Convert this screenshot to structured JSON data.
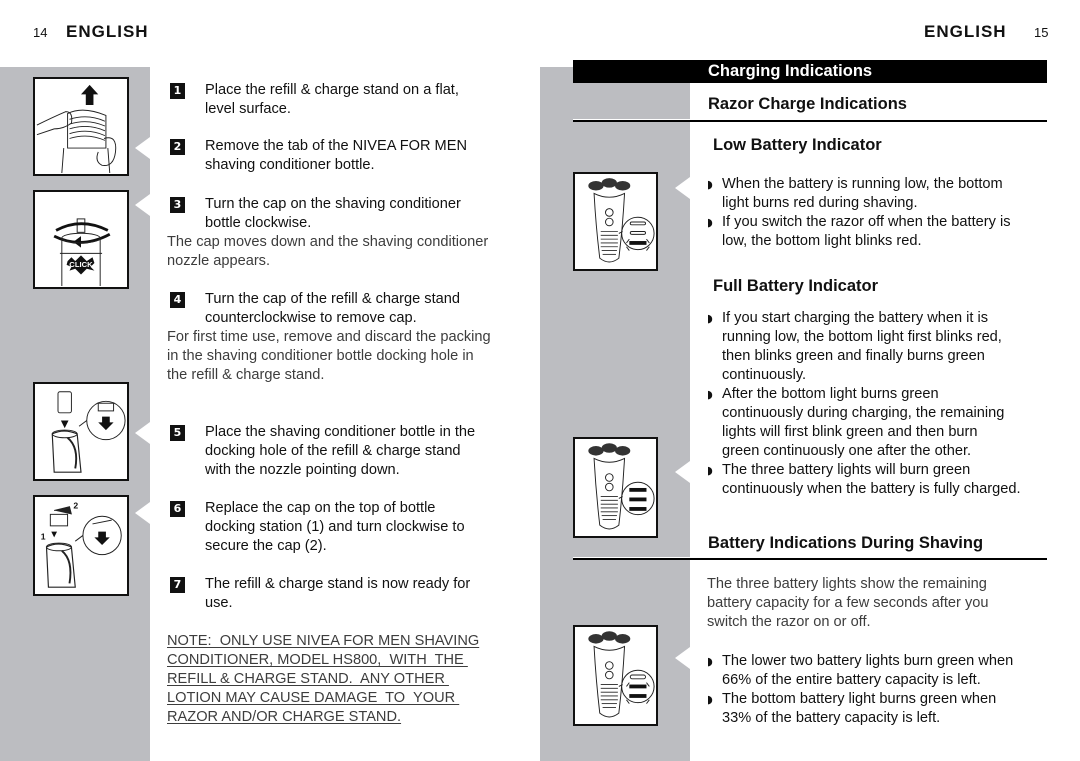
{
  "colors": {
    "panel_gray": "#bcbdc1",
    "ink": "#111111",
    "bar_black": "#000000"
  },
  "left_page": {
    "page_number": "14",
    "header": "ENGLISH",
    "illustrations": [
      {
        "name": "remove-bottle-tab-illustration"
      },
      {
        "name": "turn-bottle-cap-illustration",
        "label": "CLICK"
      },
      {
        "name": "insert-bottle-into-stand-illustration"
      },
      {
        "name": "replace-stand-cap-illustration",
        "label_1": "1",
        "label_2": "2"
      }
    ],
    "steps": [
      {
        "number": "1",
        "text": "Place the refill & charge stand on a flat,\nlevel surface."
      },
      {
        "number": "2",
        "text": "Remove the tab of the NIVEA FOR MEN\nshaving conditioner bottle."
      },
      {
        "number": "3",
        "text": "Turn the cap on the shaving conditioner\nbottle clockwise.",
        "note": "The cap moves down and the shaving conditioner\nnozzle appears."
      },
      {
        "number": "4",
        "text": "Turn the cap of the refill & charge stand\ncounterclockwise to remove cap.",
        "note": "For first time use, remove and discard the packing\nin the shaving conditioner bottle docking hole in\nthe refill & charge stand."
      },
      {
        "number": "5",
        "text": "Place the shaving conditioner bottle in the\ndocking hole of the refill & charge stand\nwith the nozzle pointing down."
      },
      {
        "number": "6",
        "text": "Replace the cap on the top of bottle\ndocking station (1) and turn clockwise to\nsecure the cap (2)."
      },
      {
        "number": "7",
        "text": "The refill & charge stand is now ready for\nuse."
      }
    ],
    "warning": "NOTE:  ONLY USE NIVEA FOR MEN SHAVING\nCONDITIONER, MODEL HS800,  WITH  THE \nREFILL & CHARGE STAND.  ANY OTHER \nLOTION MAY CAUSE DAMAGE  TO  YOUR \nRAZOR AND/OR CHARGE STAND."
  },
  "right_page": {
    "page_number": "15",
    "header": "ENGLISH",
    "section_title": "Charging Indications",
    "subsection_title": "Razor Charge Indications",
    "bullet_glyph": "◗",
    "illustrations": [
      {
        "name": "razor-low-battery-illustration"
      },
      {
        "name": "razor-full-battery-illustration"
      },
      {
        "name": "razor-shaving-battery-illustration"
      }
    ],
    "low_battery": {
      "title": "Low Battery Indicator",
      "bullets": [
        "When the battery is running low, the bottom\nlight burns red during shaving.",
        "If you switch the razor off when the battery is\nlow, the bottom light blinks red."
      ]
    },
    "full_battery": {
      "title": "Full Battery Indicator",
      "bullets": [
        "If you start charging the battery when it is\nrunning low, the bottom light first blinks red,\nthen blinks green and finally burns green\ncontinuously.",
        "After the bottom light burns green\ncontinuously during charging, the remaining\nlights will first blink green and then burn\ngreen continuously one after the other.",
        "The three battery lights will burn green\ncontinuously when the battery is fully charged."
      ]
    },
    "during_shaving": {
      "title": "Battery Indications During Shaving",
      "intro": "The three battery lights show the remaining\nbattery capacity for a few seconds after you\nswitch the razor on or off.",
      "bullets": [
        "The lower two battery lights burn green when\n66% of the entire battery capacity is left.",
        "The bottom battery light burns green when\n33% of the battery capacity is left."
      ]
    }
  }
}
